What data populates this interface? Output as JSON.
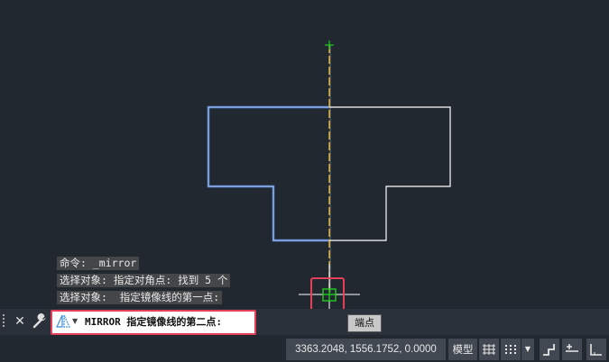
{
  "history": {
    "line1": "命令: _mirror",
    "line2": "选择对象: 指定对角点: 找到 5 个",
    "line3": "选择对象:  指定镜像线的第一点:"
  },
  "tooltip": {
    "label": "端点"
  },
  "command_line": {
    "close_glyph": "✕",
    "caret_glyph": "▼",
    "prompt": "MIRROR 指定镜像线的第二点:"
  },
  "status_bar": {
    "coordinates": "3363.2048, 1556.1752, 0.0000",
    "model_label": "模型",
    "dropdown_glyph": "▼"
  },
  "colors": {
    "background": "#212830",
    "selected_outline": "#4a86e8",
    "unselected_outline": "#ffffff",
    "mirror_line": "#f0c040",
    "snap_marker": "#22cc22",
    "highlight_frame": "#e4405a"
  }
}
